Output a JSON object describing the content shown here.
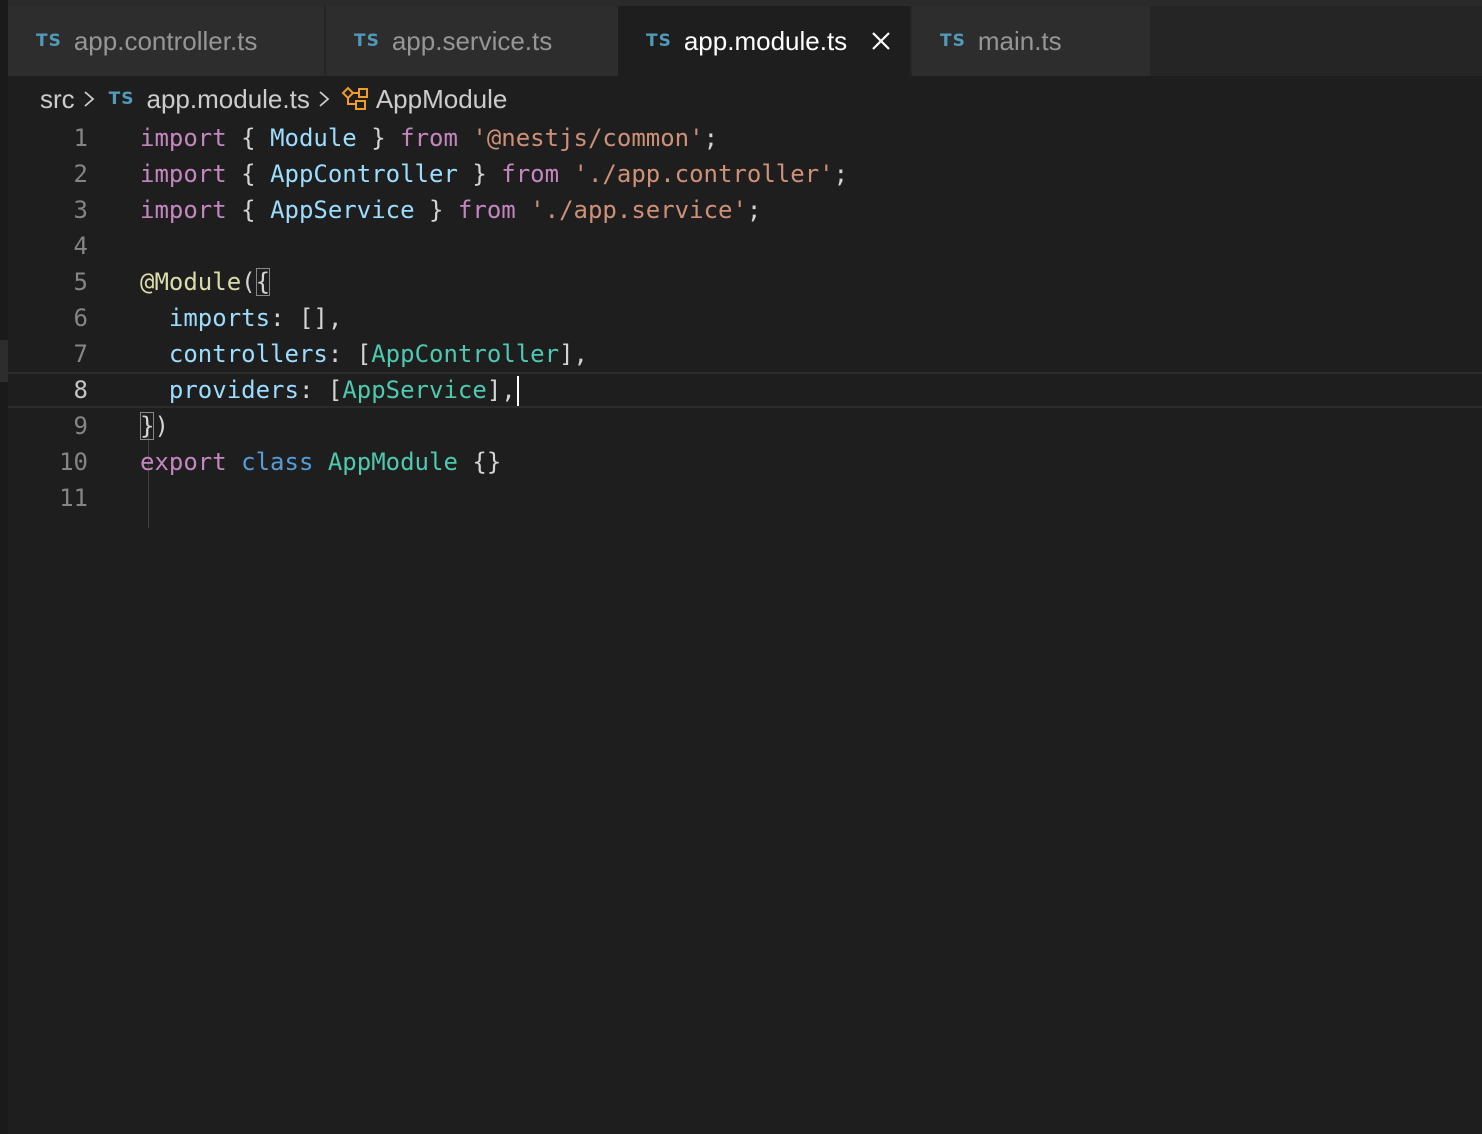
{
  "tabs": [
    {
      "badge": "TS",
      "label": "app.controller.ts",
      "active": false
    },
    {
      "badge": "TS",
      "label": "app.service.ts",
      "active": false
    },
    {
      "badge": "TS",
      "label": "app.module.ts",
      "active": true
    },
    {
      "badge": "TS",
      "label": "main.ts",
      "active": false
    }
  ],
  "breadcrumb": {
    "folder": "src",
    "file_badge": "TS",
    "file": "app.module.ts",
    "symbol": "AppModule",
    "symbol_icon": "class-icon"
  },
  "editor": {
    "current_line": 8,
    "lines": [
      {
        "n": "1",
        "text": "import { Module } from '@nestjs/common';"
      },
      {
        "n": "2",
        "text": "import { AppController } from './app.controller';"
      },
      {
        "n": "3",
        "text": "import { AppService } from './app.service';"
      },
      {
        "n": "4",
        "text": ""
      },
      {
        "n": "5",
        "text": "@Module({"
      },
      {
        "n": "6",
        "text": "  imports: [],"
      },
      {
        "n": "7",
        "text": "  controllers: [AppController],"
      },
      {
        "n": "8",
        "text": "  providers: [AppService],"
      },
      {
        "n": "9",
        "text": "})"
      },
      {
        "n": "10",
        "text": "export class AppModule {}"
      },
      {
        "n": "11",
        "text": ""
      }
    ]
  },
  "colors": {
    "background": "#1e1e1e",
    "tab_inactive": "#2d2d2d",
    "ts_badge": "#519aba",
    "keyword": "#c586c0",
    "string": "#ce9178",
    "class_name": "#4ec9b0",
    "variable": "#9cdcfe",
    "decorator": "#dcdcaa",
    "storage": "#569cd6",
    "symbol_icon": "#ee9d28"
  }
}
